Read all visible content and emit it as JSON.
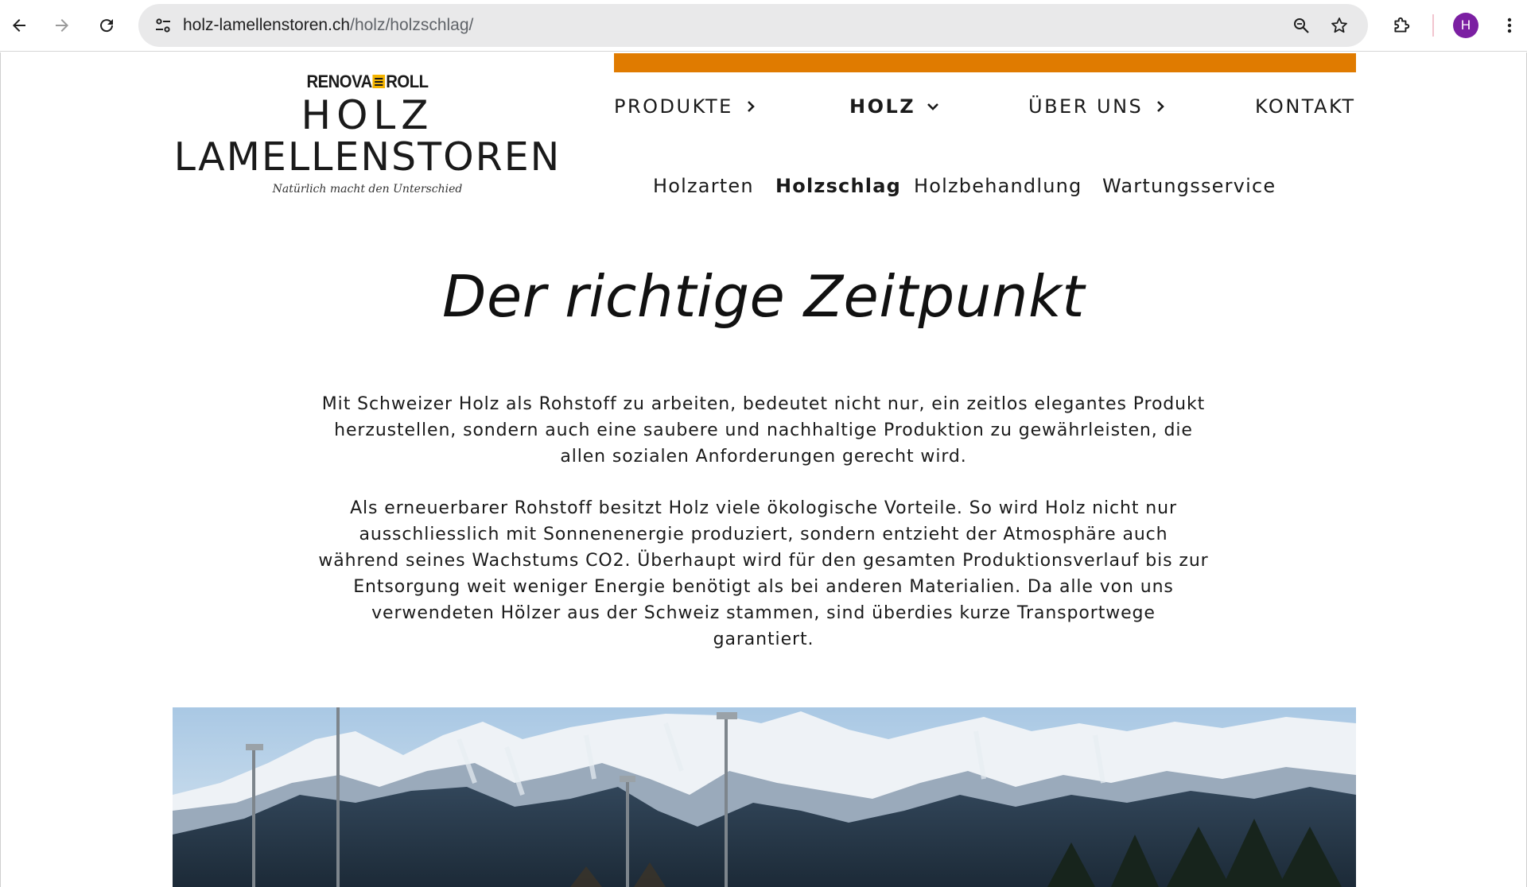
{
  "browser": {
    "url_host": "holz-lamellenstoren.ch",
    "url_path": "/holz/holzschlag/",
    "avatar_letter": "H",
    "icons": [
      "back-icon",
      "forward-icon",
      "reload-icon",
      "site-settings-icon",
      "zoom-icon",
      "star-icon",
      "extensions-icon",
      "kebab-menu-icon"
    ]
  },
  "logo": {
    "brand_left": "RENOVA",
    "brand_right": "ROLL",
    "line1": "HOLZ",
    "line2": "LAMELLENSTOREN",
    "tagline": "Natürlich macht den Unterschied"
  },
  "colors": {
    "accent": "#e07b00",
    "avatar": "#7b1fa2"
  },
  "nav": {
    "main": [
      {
        "label": "PRODUKTE",
        "chevron": "chevron-right"
      },
      {
        "label": "HOLZ",
        "chevron": "chevron-down",
        "active": true
      },
      {
        "label": "ÜBER UNS",
        "chevron": "chevron-right"
      },
      {
        "label": "KONTAKT"
      }
    ],
    "sub": [
      {
        "label": "Holzarten"
      },
      {
        "label": "Holzschlag",
        "active": true
      },
      {
        "label": "Holzbehandlung"
      },
      {
        "label": "Wartungsservice"
      }
    ]
  },
  "content": {
    "title": "Der richtige Zeitpunkt",
    "paragraph1": "Mit Schweizer Holz als Rohstoff zu arbeiten, bedeutet nicht nur, ein zeitlos elegantes Produkt herzustellen, sondern auch eine saubere und nachhaltige Produktion zu gewährleisten, die allen sozialen Anforderungen gerecht wird.",
    "paragraph2": "Als erneuerbarer Rohstoff besitzt Holz viele ökologische Vorteile. So wird Holz nicht nur ausschliesslich mit Sonnenenergie produziert, sondern entzieht der Atmosphäre auch während seines Wachstums CO2. Überhaupt wird für den gesamten Produktionsverlauf bis zur Entsorgung weit weniger Energie benötigt als bei anderen Materialien. Da alle von uns verwendeten Hölzer aus der Schweiz stammen, sind überdies kurze Transportwege garantiert."
  }
}
